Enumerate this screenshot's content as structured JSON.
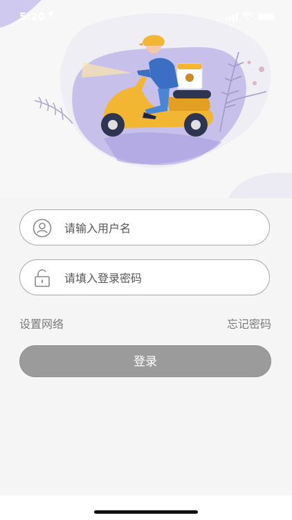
{
  "status_bar": {
    "time": "5:20"
  },
  "form": {
    "username_placeholder": "请输入用户名",
    "password_placeholder": "请填入登录密码",
    "network_settings_label": "设置网络",
    "forgot_password_label": "忘记密码",
    "login_label": "登录"
  },
  "colors": {
    "accent_purple": "#b9b2e6",
    "scooter_yellow": "#f2b632",
    "rider_blue": "#3b6fc4",
    "button_gray": "#9b9b9b"
  }
}
